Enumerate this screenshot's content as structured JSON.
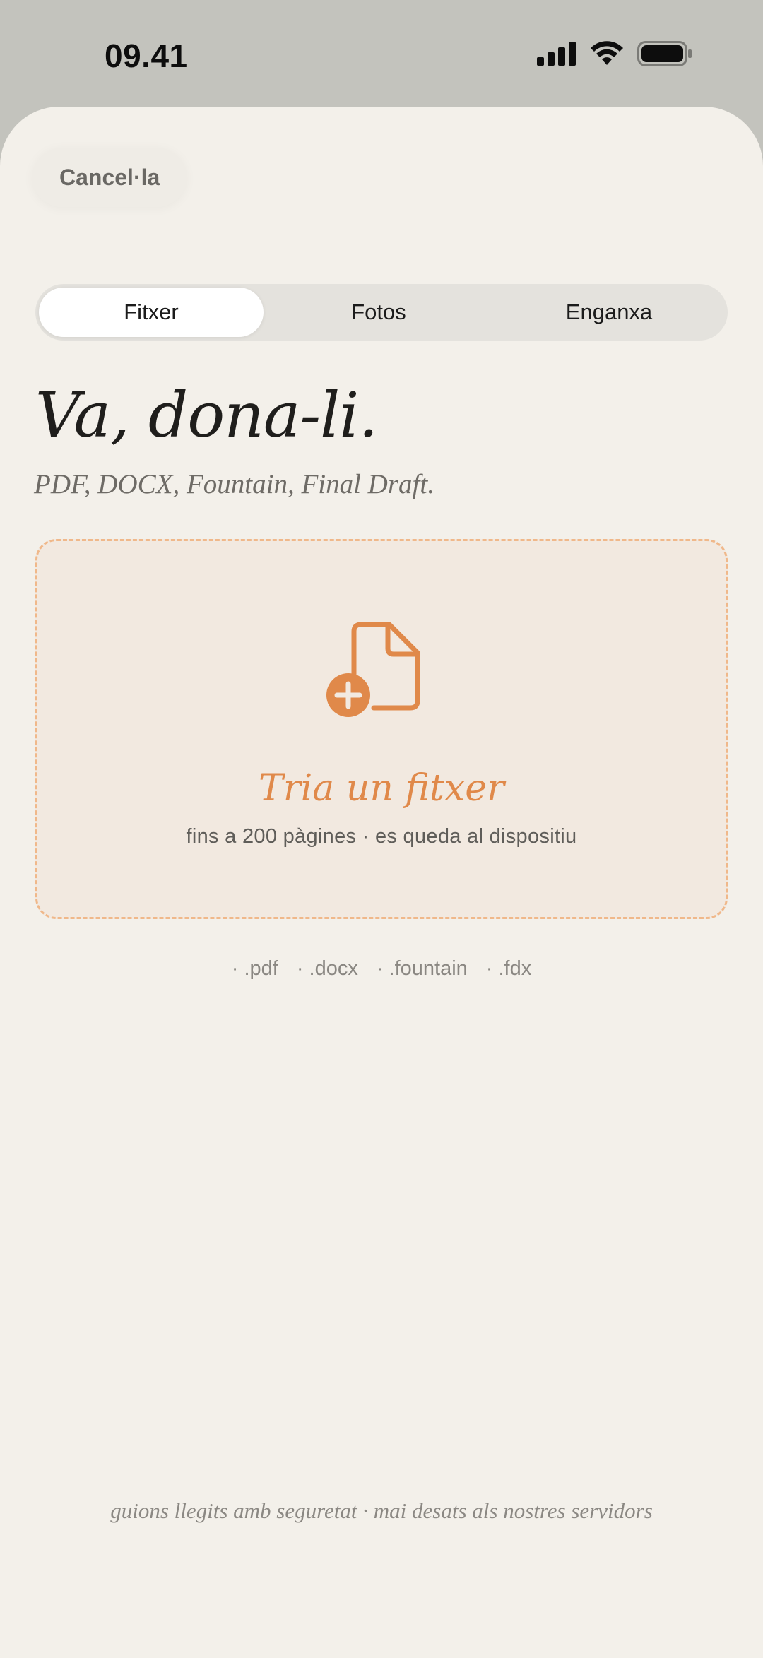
{
  "status_bar": {
    "time": "09.41",
    "icons": [
      "cellular-signal-icon",
      "wifi-icon",
      "battery-icon"
    ]
  },
  "header": {
    "cancel_label": "Cancel·la"
  },
  "tabs": [
    {
      "label": "Fitxer",
      "active": true
    },
    {
      "label": "Fotos",
      "active": false
    },
    {
      "label": "Enganxa",
      "active": false
    }
  ],
  "main": {
    "headline": "Va, dona-li.",
    "subheadline": "PDF, DOCX, Fountain, Final Draft."
  },
  "dropzone": {
    "icon": "file-add-icon",
    "title": "Tria un fitxer",
    "subtitle": "fins a 200 pàgines · es queda al dispositiu"
  },
  "extensions": [
    ".pdf",
    ".docx",
    ".fountain",
    ".fdx"
  ],
  "footer": {
    "note": "guions llegits amb seguretat · mai desats als nostres servidors"
  },
  "colors": {
    "accent": "#e0894a",
    "sheet_background": "#f3f0ea",
    "dropzone_background": "#f2e9e0",
    "dropzone_border": "#f0b88a"
  }
}
